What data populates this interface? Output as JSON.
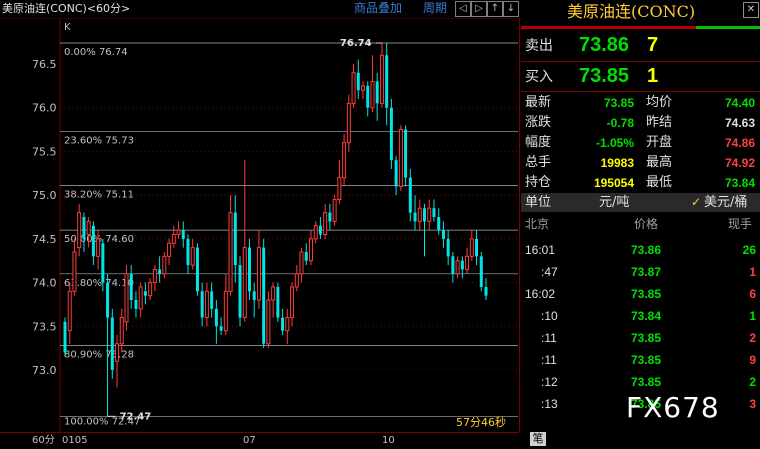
{
  "chart": {
    "title": "美原油连(CONC)<60分>",
    "link_goods": "商品叠加",
    "link_period": "周期",
    "nav_icons": [
      "arrow-left-icon",
      "arrow-right-icon",
      "zoom-in-icon",
      "zoom-out-icon"
    ],
    "k_label": "K",
    "period_label": "60分",
    "countdown": "57分46秒",
    "high_marker": "76.74",
    "low_marker": "72.47",
    "x_ticks": [
      "0105",
      "07",
      "10"
    ]
  },
  "chart_data": {
    "type": "candlestick",
    "y_ticks": [
      "76.5",
      "76.0",
      "75.5",
      "75.0",
      "74.5",
      "74.0",
      "73.5",
      "73.0"
    ],
    "ylim": [
      72.4,
      76.9
    ],
    "fib_levels": [
      {
        "label": "0.00% 76.74",
        "value": 76.74
      },
      {
        "label": "23.60% 75.73",
        "value": 75.73
      },
      {
        "label": "38.20% 75.11",
        "value": 75.11
      },
      {
        "label": "50.00% 74.60",
        "value": 74.6
      },
      {
        "label": "61.80% 74.10",
        "value": 74.1
      },
      {
        "label": "80.90% 73.28",
        "value": 73.28
      },
      {
        "label": "100.00% 72.47",
        "value": 72.47
      }
    ],
    "candles": [
      [
        73.55,
        73.2,
        73.6,
        73.15
      ],
      [
        73.45,
        73.9,
        74.0,
        73.3
      ],
      [
        73.9,
        74.35,
        74.5,
        73.85
      ],
      [
        74.4,
        74.8,
        74.9,
        74.3
      ],
      [
        74.75,
        74.5,
        74.8,
        74.35
      ],
      [
        74.55,
        74.7,
        74.75,
        74.4
      ],
      [
        74.65,
        74.3,
        74.7,
        74.2
      ],
      [
        74.3,
        74.5,
        74.6,
        74.15
      ],
      [
        74.45,
        74.0,
        74.5,
        73.9
      ],
      [
        74.0,
        73.6,
        74.1,
        72.47
      ],
      [
        73.6,
        73.0,
        73.7,
        72.9
      ],
      [
        73.1,
        73.3,
        73.4,
        72.8
      ],
      [
        73.3,
        73.6,
        73.7,
        73.2
      ],
      [
        73.55,
        74.1,
        74.2,
        73.45
      ],
      [
        74.1,
        73.8,
        74.2,
        73.7
      ],
      [
        73.8,
        73.7,
        73.9,
        73.6
      ],
      [
        73.7,
        73.95,
        74.0,
        73.6
      ],
      [
        73.9,
        73.85,
        74.0,
        73.75
      ],
      [
        73.85,
        74.0,
        74.05,
        73.8
      ],
      [
        74.0,
        74.15,
        74.2,
        73.9
      ],
      [
        74.15,
        74.1,
        74.3,
        74.0
      ],
      [
        74.1,
        74.3,
        74.35,
        74.05
      ],
      [
        74.3,
        74.45,
        74.5,
        74.2
      ],
      [
        74.45,
        74.55,
        74.65,
        74.4
      ],
      [
        74.55,
        74.6,
        74.7,
        74.5
      ],
      [
        74.6,
        74.5,
        74.7,
        74.4
      ],
      [
        74.5,
        74.2,
        74.55,
        74.1
      ],
      [
        74.2,
        74.4,
        74.5,
        74.15
      ],
      [
        74.4,
        73.9,
        74.45,
        73.85
      ],
      [
        73.9,
        73.6,
        74.0,
        73.5
      ],
      [
        73.6,
        73.9,
        74.0,
        73.5
      ],
      [
        73.9,
        73.7,
        74.0,
        73.6
      ],
      [
        73.7,
        73.5,
        73.8,
        73.3
      ],
      [
        73.5,
        73.45,
        73.6,
        73.4
      ],
      [
        73.45,
        73.9,
        74.1,
        73.4
      ],
      [
        73.9,
        74.8,
        75.0,
        73.85
      ],
      [
        74.8,
        74.2,
        75.0,
        74.0
      ],
      [
        74.2,
        73.6,
        74.3,
        73.5
      ],
      [
        73.6,
        74.4,
        75.4,
        73.55
      ],
      [
        74.4,
        73.9,
        74.5,
        73.8
      ],
      [
        73.9,
        73.8,
        74.0,
        73.6
      ],
      [
        73.8,
        74.4,
        74.6,
        73.7
      ],
      [
        74.4,
        73.3,
        74.5,
        73.25
      ],
      [
        73.3,
        73.8,
        73.9,
        73.25
      ],
      [
        73.8,
        73.95,
        74.0,
        73.6
      ],
      [
        73.95,
        73.6,
        74.0,
        73.55
      ],
      [
        73.6,
        73.45,
        73.7,
        73.4
      ],
      [
        73.45,
        73.6,
        73.7,
        73.3
      ],
      [
        73.6,
        73.95,
        74.0,
        73.5
      ],
      [
        73.95,
        74.1,
        74.2,
        73.9
      ],
      [
        74.1,
        74.35,
        74.4,
        74.0
      ],
      [
        74.35,
        74.25,
        74.45,
        74.2
      ],
      [
        74.25,
        74.5,
        74.6,
        74.2
      ],
      [
        74.5,
        74.65,
        74.7,
        74.45
      ],
      [
        74.65,
        74.55,
        74.75,
        74.5
      ],
      [
        74.55,
        74.8,
        74.9,
        74.5
      ],
      [
        74.8,
        74.7,
        74.9,
        74.6
      ],
      [
        74.7,
        74.95,
        75.0,
        74.65
      ],
      [
        74.95,
        75.2,
        75.4,
        74.9
      ],
      [
        75.2,
        75.6,
        75.7,
        75.1
      ],
      [
        75.6,
        76.05,
        76.15,
        75.5
      ],
      [
        76.05,
        76.4,
        76.5,
        76.0
      ],
      [
        76.4,
        76.2,
        76.55,
        76.1
      ],
      [
        76.2,
        76.25,
        76.3,
        76.1
      ],
      [
        76.25,
        76.0,
        76.3,
        75.9
      ],
      [
        76.0,
        76.3,
        76.6,
        75.95
      ],
      [
        76.3,
        76.05,
        76.4,
        75.85
      ],
      [
        76.05,
        76.6,
        76.74,
        76.0
      ],
      [
        76.6,
        76.0,
        76.74,
        75.8
      ],
      [
        76.0,
        75.4,
        76.1,
        75.3
      ],
      [
        75.4,
        75.1,
        75.45,
        75.0
      ],
      [
        75.1,
        75.75,
        75.8,
        75.05
      ],
      [
        75.75,
        75.2,
        75.8,
        75.1
      ],
      [
        75.2,
        74.8,
        75.3,
        74.7
      ],
      [
        74.8,
        74.7,
        75.0,
        74.6
      ],
      [
        74.7,
        74.85,
        74.95,
        74.6
      ],
      [
        74.85,
        74.7,
        74.9,
        74.3
      ],
      [
        74.7,
        74.85,
        74.95,
        74.6
      ],
      [
        74.85,
        74.75,
        74.95,
        74.7
      ],
      [
        74.75,
        74.6,
        74.85,
        74.55
      ],
      [
        74.6,
        74.5,
        74.7,
        74.4
      ],
      [
        74.5,
        74.3,
        74.6,
        74.2
      ],
      [
        74.3,
        74.1,
        74.35,
        74.0
      ],
      [
        74.1,
        74.25,
        74.3,
        74.05
      ],
      [
        74.25,
        74.15,
        74.3,
        74.05
      ],
      [
        74.15,
        74.3,
        74.4,
        74.1
      ],
      [
        74.3,
        74.5,
        74.6,
        74.25
      ],
      [
        74.5,
        74.3,
        74.6,
        74.2
      ],
      [
        74.3,
        73.95,
        74.35,
        73.9
      ],
      [
        73.95,
        73.85,
        74.05,
        73.8
      ]
    ]
  },
  "quote": {
    "title": "美原油连(CONC)",
    "sell_label": "卖出",
    "sell_price": "73.86",
    "sell_vol": "7",
    "buy_label": "买入",
    "buy_price": "73.85",
    "buy_vol": "1",
    "stats": [
      {
        "l1": "最新",
        "v1": "73.85",
        "c1": "g",
        "l2": "均价",
        "v2": "74.40",
        "c2": "g"
      },
      {
        "l1": "涨跌",
        "v1": "-0.78",
        "c1": "g",
        "l2": "昨结",
        "v2": "74.63",
        "c2": "w"
      },
      {
        "l1": "幅度",
        "v1": "-1.05%",
        "c1": "g",
        "l2": "开盘",
        "v2": "74.86",
        "c2": "r"
      },
      {
        "l1": "总手",
        "v1": "19983",
        "c1": "y",
        "l2": "最高",
        "v2": "74.92",
        "c2": "r"
      },
      {
        "l1": "持仓",
        "v1": "195054",
        "c1": "y",
        "l2": "最低",
        "v2": "73.84",
        "c2": "g"
      }
    ],
    "unit_label": "单位",
    "unit_value": "元/吨",
    "unit_alt": "美元/桶",
    "col_time": "北京",
    "col_price": "价格",
    "col_vol": "现手",
    "ticks": [
      {
        "time": "16:01",
        "price": "73.86",
        "vol": "26",
        "vc": "g"
      },
      {
        "time": ":47",
        "price": "73.87",
        "vol": "1",
        "vc": "r"
      },
      {
        "time": "16:02",
        "price": "73.85",
        "vol": "6",
        "vc": "r"
      },
      {
        "time": ":10",
        "price": "73.84",
        "vol": "1",
        "vc": "g"
      },
      {
        "time": ":11",
        "price": "73.85",
        "vol": "2",
        "vc": "r"
      },
      {
        "time": ":11",
        "price": "73.85",
        "vol": "9",
        "vc": "r"
      },
      {
        "time": ":12",
        "price": "73.85",
        "vol": "2",
        "vc": "g"
      },
      {
        "time": ":13",
        "price": "73.85",
        "vol": "3",
        "vc": "r"
      }
    ],
    "pen_tab": "笔",
    "watermark": "FX678"
  }
}
